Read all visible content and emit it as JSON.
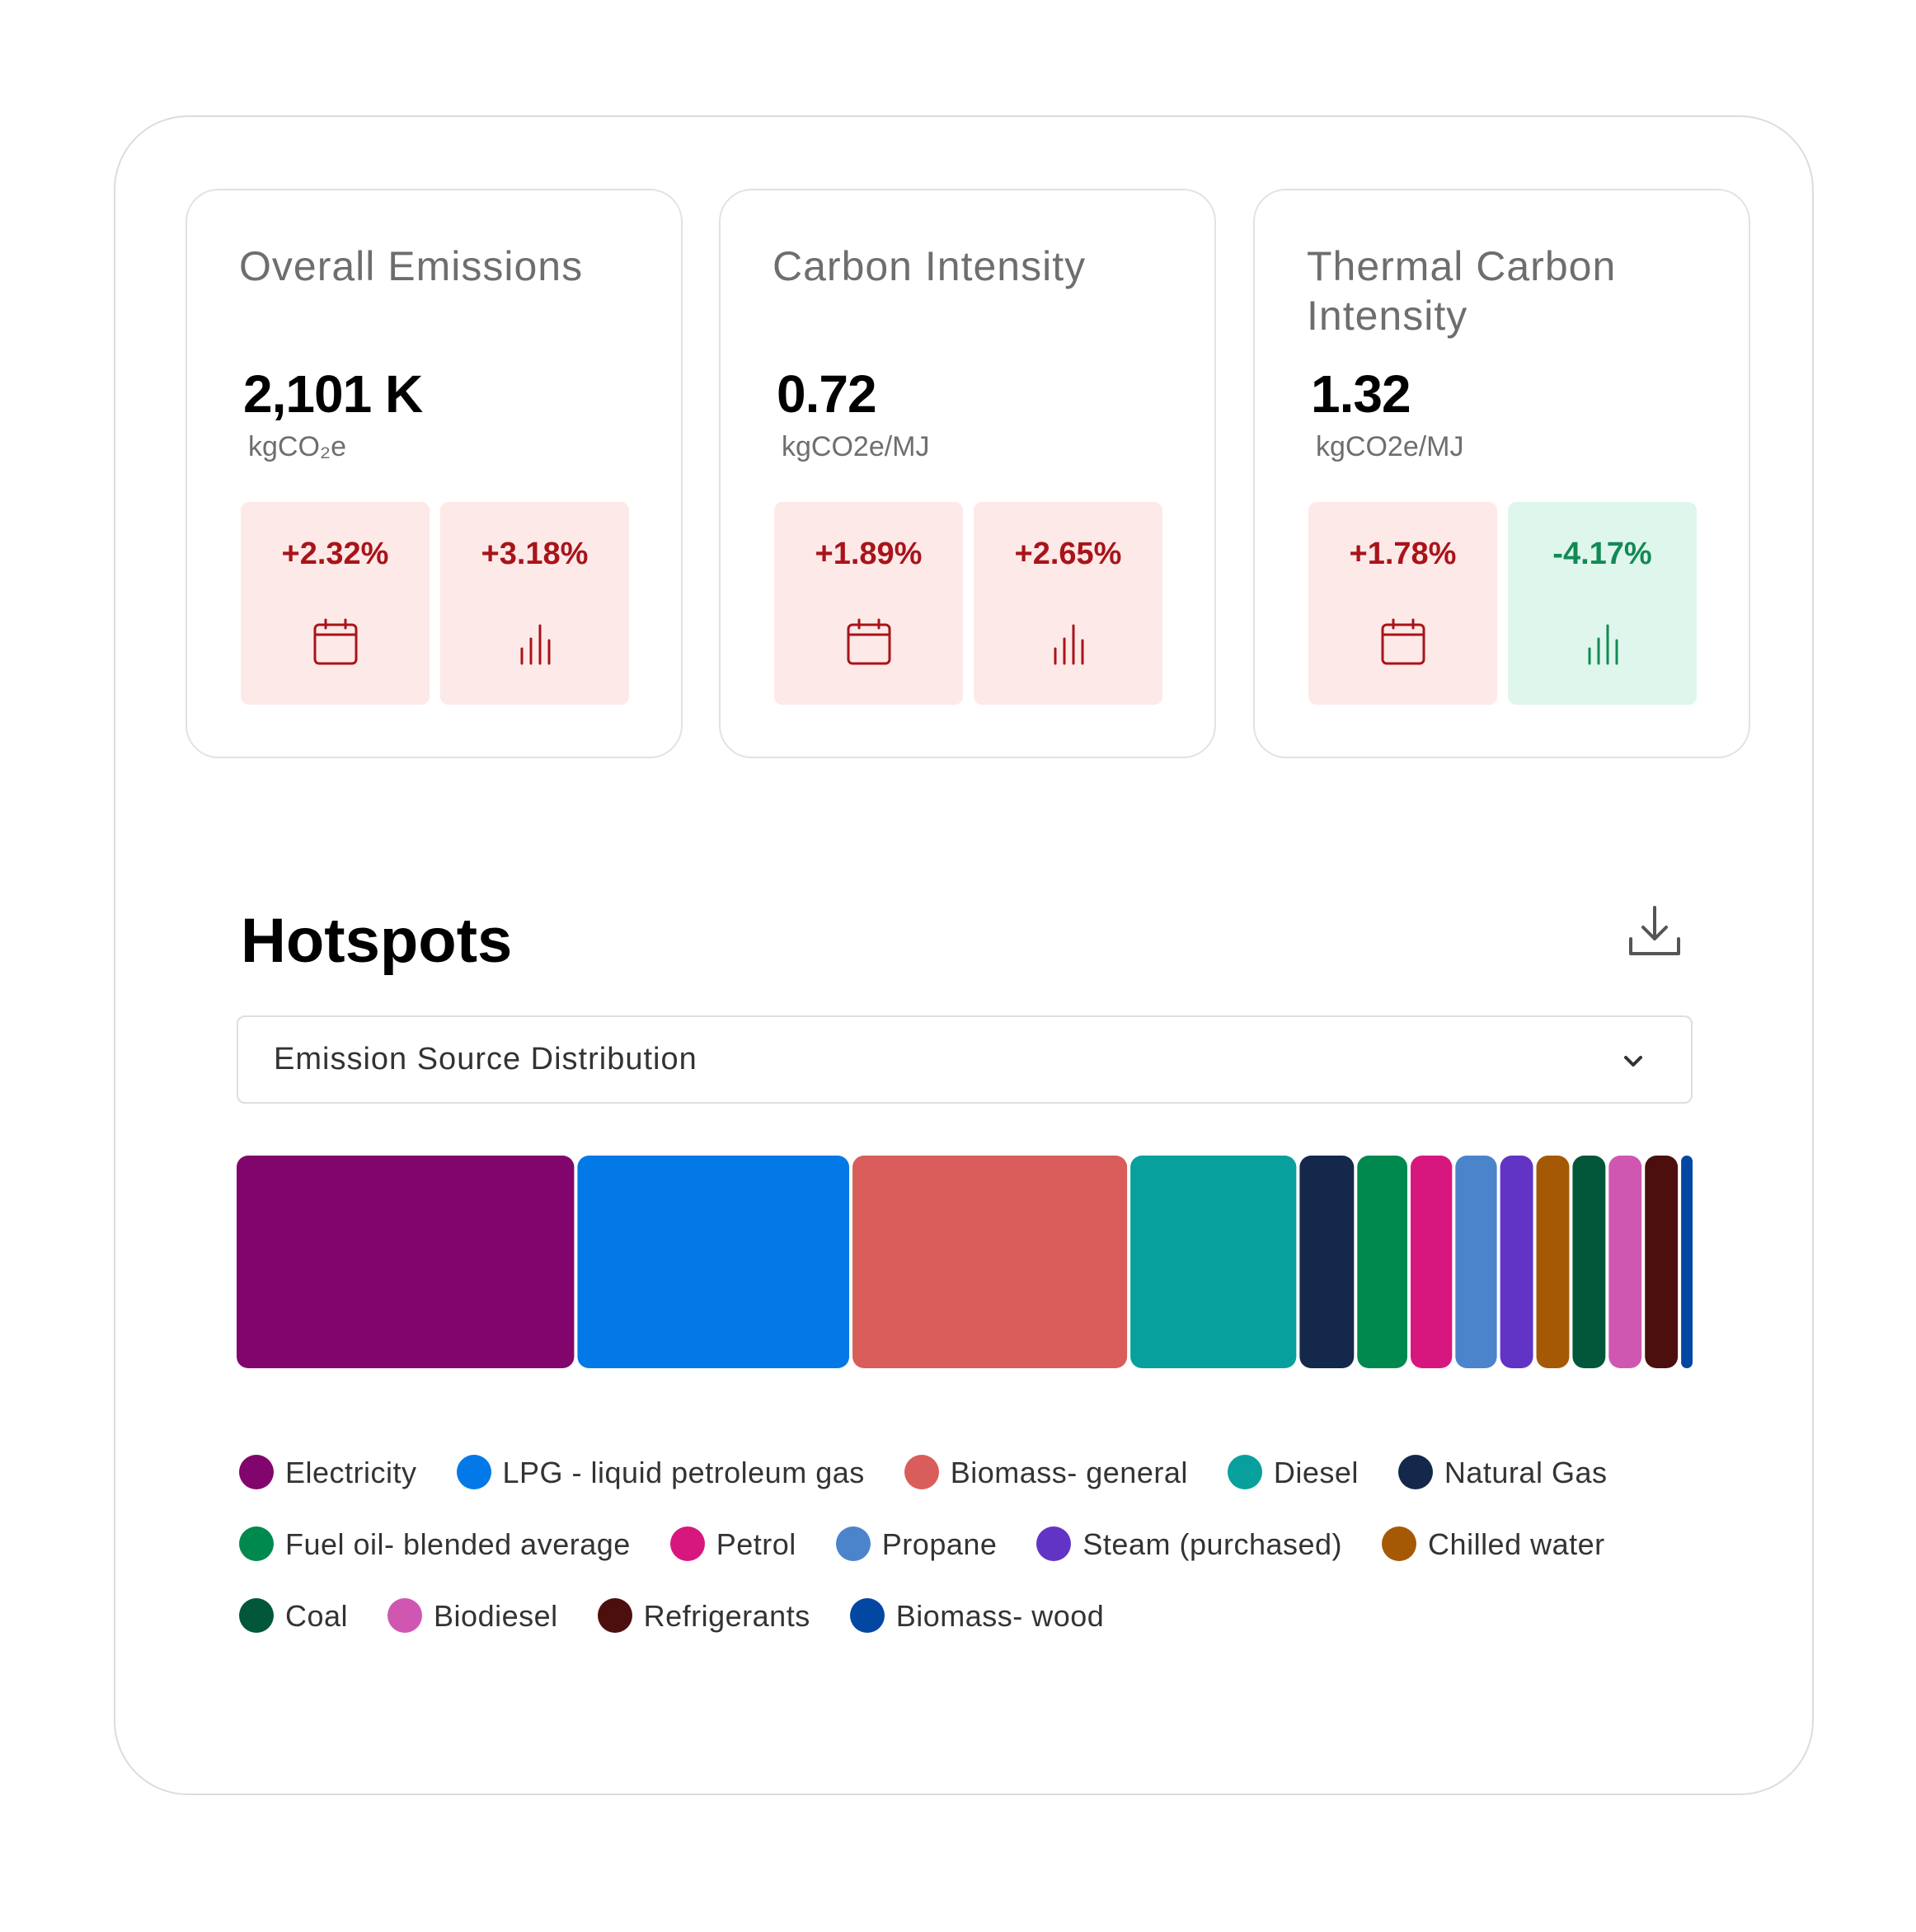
{
  "kpis": [
    {
      "title": "Overall Emissions",
      "value": "2,101 K",
      "unit": "kgCO₂e",
      "badges": [
        {
          "value": "+2.32%",
          "icon": "calendar-icon",
          "tone": "neg"
        },
        {
          "value": "+3.18%",
          "icon": "bar-chart-icon",
          "tone": "neg"
        }
      ]
    },
    {
      "title": "Carbon Intensity",
      "value": "0.72",
      "unit": "kgCO2e/MJ",
      "badges": [
        {
          "value": "+1.89%",
          "icon": "calendar-icon",
          "tone": "neg"
        },
        {
          "value": "+2.65%",
          "icon": "bar-chart-icon",
          "tone": "neg"
        }
      ]
    },
    {
      "title": "Thermal Carbon Intensity",
      "value": "1.32",
      "unit": "kgCO2e/MJ",
      "badges": [
        {
          "value": "+1.78%",
          "icon": "calendar-icon",
          "tone": "neg"
        },
        {
          "value": "-4.17%",
          "icon": "bar-chart-icon",
          "tone": "pos"
        }
      ]
    }
  ],
  "hotspots": {
    "title": "Hotspots",
    "download_icon": "download-icon",
    "dropdown": {
      "selected": "Emission Source Distribution",
      "icon": "chevron-down-icon"
    }
  },
  "colors": {
    "negative_bg": "#fde9e8",
    "negative_text": "#a8141a",
    "positive_bg": "#dff6ec",
    "positive_text": "#128a55"
  },
  "chart_data": {
    "type": "bar",
    "orientation": "horizontal-stacked-100",
    "categories": [
      "Electricity",
      "LPG - liquid petroleum gas",
      "Biomass- general",
      "Diesel",
      "Natural Gas",
      "Fuel oil- blended average",
      "Petrol",
      "Propane",
      "Steam (purchased)",
      "Chilled water",
      "Coal",
      "Biodiesel",
      "Refrigerants",
      "Biomass- wood"
    ],
    "values": [
      23.6,
      19.0,
      19.2,
      11.6,
      3.8,
      3.5,
      2.9,
      2.9,
      2.3,
      2.3,
      2.3,
      2.3,
      2.3,
      0.8
    ],
    "colors": [
      "#81056c",
      "#0279e6",
      "#d95d5a",
      "#08a09c",
      "#13284a",
      "#00894f",
      "#d8177e",
      "#4c84cc",
      "#6134c5",
      "#a65904",
      "#02573a",
      "#cf57b2",
      "#4c0f0e",
      "#0248a2"
    ],
    "legend": "bottom"
  }
}
